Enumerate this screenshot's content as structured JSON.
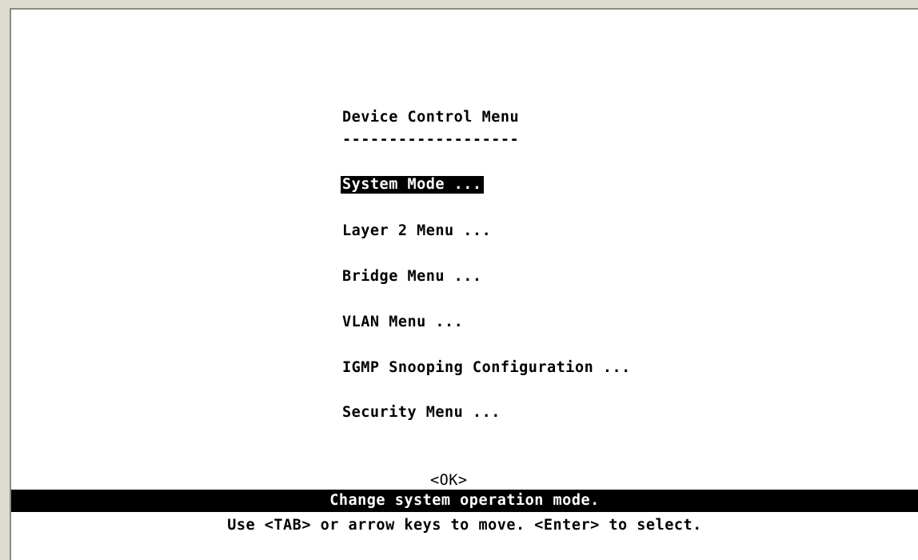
{
  "menu": {
    "title": "Device Control Menu",
    "underline": "-------------------",
    "items": [
      {
        "label": "System Mode ..."
      },
      {
        "label": "Layer 2 Menu ..."
      },
      {
        "label": "Bridge Menu ..."
      },
      {
        "label": "VLAN Menu ..."
      },
      {
        "label": "IGMP Snooping Configuration ..."
      },
      {
        "label": "Security Menu ..."
      }
    ],
    "ok_label": "<OK>"
  },
  "status": {
    "message": "Change system operation mode.",
    "help": "Use <TAB> or arrow keys to move. <Enter> to select."
  },
  "colors": {
    "background": "#ffffff",
    "text": "#000000",
    "highlight": "#000000",
    "frame": "#dcdcd0"
  }
}
